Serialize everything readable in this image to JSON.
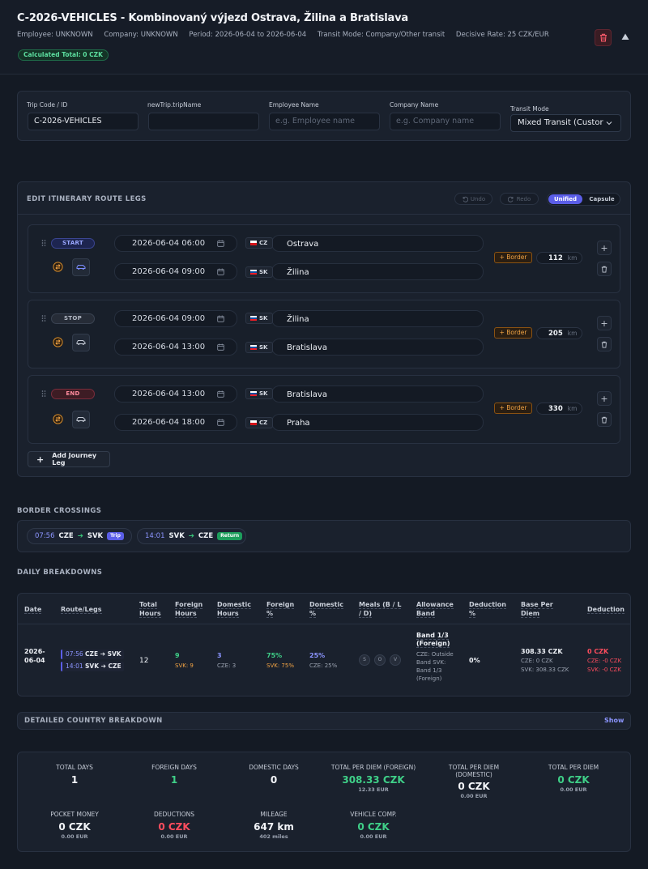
{
  "header": {
    "title": "C-2026-VEHICLES - Kombinovaný výjezd Ostrava, Žilina a Bratislava",
    "employee": "Employee: UNKNOWN",
    "company": "Company: UNKNOWN",
    "period": "Period: 2026-06-04 to 2026-06-04",
    "transit_mode": "Transit Mode: Company/Other transit",
    "decisive_rate": "Decisive Rate: 25 CZK/EUR",
    "calculated_total": "Calculated Total: 0 CZK"
  },
  "form": {
    "trip_code_label": "Trip Code / ID",
    "trip_code_value": "C-2026-VEHICLES",
    "trip_name_label": "newTrip.tripName",
    "trip_name_value": "",
    "employee_label": "Employee Name",
    "employee_placeholder": "e.g. Employee name",
    "company_label": "Company Name",
    "company_placeholder": "e.g. Company name",
    "transit_label": "Transit Mode",
    "transit_value": "Mixed Transit (Custor"
  },
  "itinerary": {
    "title": "EDIT ITINERARY ROUTE LEGS",
    "undo": "Undo",
    "redo": "Redo",
    "view_unified": "Unified",
    "view_capsule": "Capsule",
    "add_leg": "Add Journey Leg",
    "legs": [
      {
        "tag": "START",
        "dep_time": "2026-06-04 06:00",
        "dep_country": "CZ",
        "dep_place": "Ostrava",
        "arr_time": "2026-06-04 09:00",
        "arr_country": "SK",
        "arr_place": "Žilina",
        "border": "+ Border",
        "km": "112",
        "unit": "km"
      },
      {
        "tag": "STOP",
        "dep_time": "2026-06-04 09:00",
        "dep_country": "SK",
        "dep_place": "Žilina",
        "arr_time": "2026-06-04 13:00",
        "arr_country": "SK",
        "arr_place": "Bratislava",
        "border": "+ Border",
        "km": "205",
        "unit": "km"
      },
      {
        "tag": "END",
        "dep_time": "2026-06-04 13:00",
        "dep_country": "SK",
        "dep_place": "Bratislava",
        "arr_time": "2026-06-04 18:00",
        "arr_country": "CZ",
        "arr_place": "Praha",
        "border": "+ Border",
        "km": "330",
        "unit": "km"
      }
    ]
  },
  "crossings": {
    "title": "BORDER CROSSINGS",
    "items": [
      {
        "time": "07:56",
        "from": "CZE",
        "to": "SVK",
        "type": "Trip"
      },
      {
        "time": "14:01",
        "from": "SVK",
        "to": "CZE",
        "type": "Return"
      }
    ]
  },
  "daily": {
    "title": "DAILY BREAKDOWNS",
    "headers": {
      "date": "Date",
      "route": "Route/Legs",
      "total_hours": "Total Hours",
      "foreign_hours": "Foreign Hours",
      "domestic_hours": "Domestic Hours",
      "foreign_pct": "Foreign %",
      "domestic_pct": "Domestic %",
      "meals": "Meals (B / L / D)",
      "allowance": "Allowance Band",
      "deduction_pct": "Deduction %",
      "base": "Base Per Diem",
      "deduction": "Deduction"
    },
    "row": {
      "date": "2026-06-04",
      "route1_time": "07:56",
      "route1_text": "CZE ➔ SVK",
      "route2_time": "14:01",
      "route2_text": "SVK ➔ CZE",
      "total_hours": "12",
      "foreign_hours": "9",
      "foreign_hours_sub": "SVK: 9",
      "domestic_hours": "3",
      "domestic_hours_sub": "CZE: 3",
      "foreign_pct": "75%",
      "foreign_pct_sub": "SVK: 75%",
      "domestic_pct": "25%",
      "domestic_pct_sub": "CZE: 25%",
      "meal_b": "S",
      "meal_l": "O",
      "meal_d": "V",
      "allowance_band": "Band 1/3 (Foreign)",
      "allowance_sub": "CZE: Outside Band SVK: Band 1/3 (Foreign)",
      "deduction_pct": "0%",
      "base": "308.33 CZK",
      "base_cze": "CZE: 0 CZK",
      "base_svk": "SVK: 308.33 CZK",
      "deduction": "0 CZK",
      "deduction_cze": "CZE: -0 CZK",
      "deduction_svk": "SVK: -0 CZK"
    }
  },
  "country_breakdown": {
    "title": "DETAILED COUNTRY BREAKDOWN",
    "toggle": "Show"
  },
  "summary": {
    "total_days": {
      "label": "TOTAL DAYS",
      "value": "1"
    },
    "foreign_days": {
      "label": "FOREIGN DAYS",
      "value": "1"
    },
    "domestic_days": {
      "label": "DOMESTIC DAYS",
      "value": "0"
    },
    "total_foreign": {
      "label": "TOTAL PER DIEM (FOREIGN)",
      "value": "308.33 CZK",
      "sub": "12.33 EUR"
    },
    "total_domestic": {
      "label": "TOTAL PER DIEM (DOMESTIC)",
      "value": "0 CZK",
      "sub": "0.00 EUR"
    },
    "total_per_diem": {
      "label": "TOTAL PER DIEM",
      "value": "0 CZK",
      "sub": "0.00 EUR"
    },
    "pocket_money": {
      "label": "POCKET MONEY",
      "value": "0 CZK",
      "sub": "0.00 EUR"
    },
    "deductions": {
      "label": "DEDUCTIONS",
      "value": "0 CZK",
      "sub": "0.00 EUR"
    },
    "mileage": {
      "label": "MILEAGE",
      "value": "647 km",
      "sub": "402 miles"
    },
    "vehicle_comp": {
      "label": "VEHICLE COMP.",
      "value": "0 CZK",
      "sub": "0.00 EUR"
    }
  },
  "colors": {
    "accent": "#5b5ee8",
    "success": "#3fd088",
    "danger": "#ff4d5e",
    "warning": "#f3a444"
  }
}
